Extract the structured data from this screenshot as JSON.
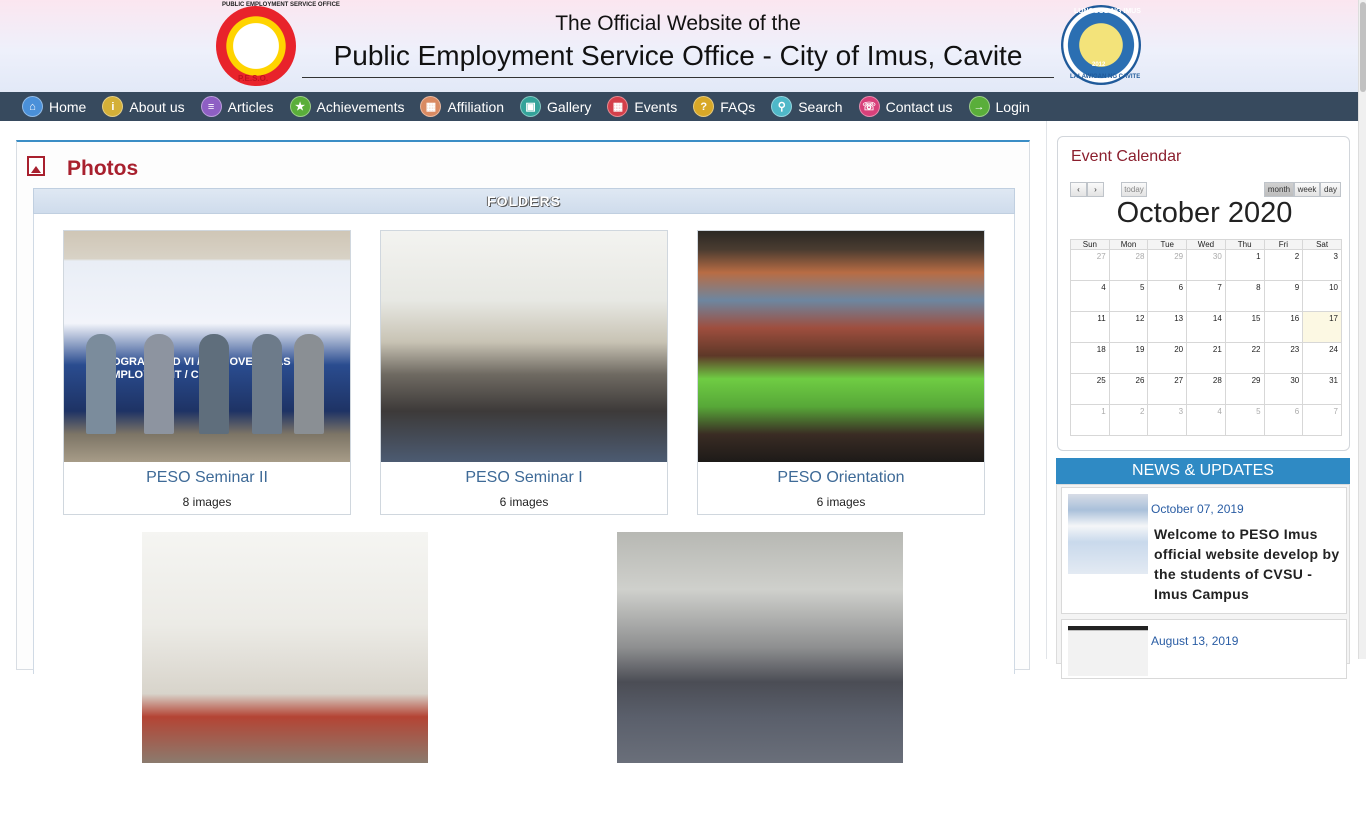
{
  "header": {
    "line1": "The Official Website of the",
    "line2": "Public Employment Service Office - City of Imus, Cavite",
    "left_seal_text": "PUBLIC EMPLOYMENT SERVICE OFFICE",
    "left_seal_bottom": "P.E.S.O.",
    "right_seal_text": "LUNGSOD NG IMUS",
    "right_seal_bottom": "LALAWIGAN NG CAVITE",
    "right_seal_year": "2012"
  },
  "nav": [
    {
      "label": "Home",
      "icon": "home-icon",
      "color": "#4a90d9"
    },
    {
      "label": "About us",
      "icon": "info-icon",
      "color": "#d4b038"
    },
    {
      "label": "Articles",
      "icon": "articles-icon",
      "color": "#8e5fc4"
    },
    {
      "label": "Achievements",
      "icon": "trophy-icon",
      "color": "#5aae3a"
    },
    {
      "label": "Affiliation",
      "icon": "affiliation-icon",
      "color": "#d98a62"
    },
    {
      "label": "Gallery",
      "icon": "gallery-icon",
      "color": "#34a39a"
    },
    {
      "label": "Events",
      "icon": "calendar-icon",
      "color": "#d43f4a"
    },
    {
      "label": "FAQs",
      "icon": "help-icon",
      "color": "#d8a828"
    },
    {
      "label": "Search",
      "icon": "search-icon",
      "color": "#4fb8c8"
    },
    {
      "label": "Contact us",
      "icon": "phone-icon",
      "color": "#d8407a"
    },
    {
      "label": "Login",
      "icon": "login-icon",
      "color": "#5aae3a"
    }
  ],
  "main": {
    "title": "Photos",
    "folders_label": "FOLDERS",
    "albums": [
      {
        "name": "PESO Seminar II",
        "count": "8 images"
      },
      {
        "name": "PESO Seminar I",
        "count": "6 images"
      },
      {
        "name": "PESO Orientation",
        "count": "6 images"
      }
    ],
    "thumb_text": "ROGRAM AND VI / FOR OVERSEAS EMPLOYMENT / CAVI"
  },
  "calendar": {
    "title": "Event Calendar",
    "today_label": "today",
    "month_label": "month",
    "week_label": "week",
    "day_label": "day",
    "prev_label": "‹",
    "next_label": "›",
    "month_title": "October 2020",
    "weekdays": [
      "Sun",
      "Mon",
      "Tue",
      "Wed",
      "Thu",
      "Fri",
      "Sat"
    ],
    "weeks": [
      [
        "27",
        "28",
        "29",
        "30",
        "1",
        "2",
        "3"
      ],
      [
        "4",
        "5",
        "6",
        "7",
        "8",
        "9",
        "10"
      ],
      [
        "11",
        "12",
        "13",
        "14",
        "15",
        "16",
        "17"
      ],
      [
        "18",
        "19",
        "20",
        "21",
        "22",
        "23",
        "24"
      ],
      [
        "25",
        "26",
        "27",
        "28",
        "29",
        "30",
        "31"
      ],
      [
        "1",
        "2",
        "3",
        "4",
        "5",
        "6",
        "7"
      ]
    ],
    "today": "17"
  },
  "news": {
    "header": "NEWS & UPDATES",
    "items": [
      {
        "date": "October 07, 2019",
        "title": "Welcome to PESO Imus official website develop by the students of CVSU - Imus Campus"
      },
      {
        "date": "August 13, 2019",
        "title": ""
      }
    ]
  },
  "colors": {
    "nav_bg": "#374a5e",
    "accent_red": "#a8202e",
    "link_blue": "#3e6a97",
    "news_header": "#2f8ac4"
  }
}
